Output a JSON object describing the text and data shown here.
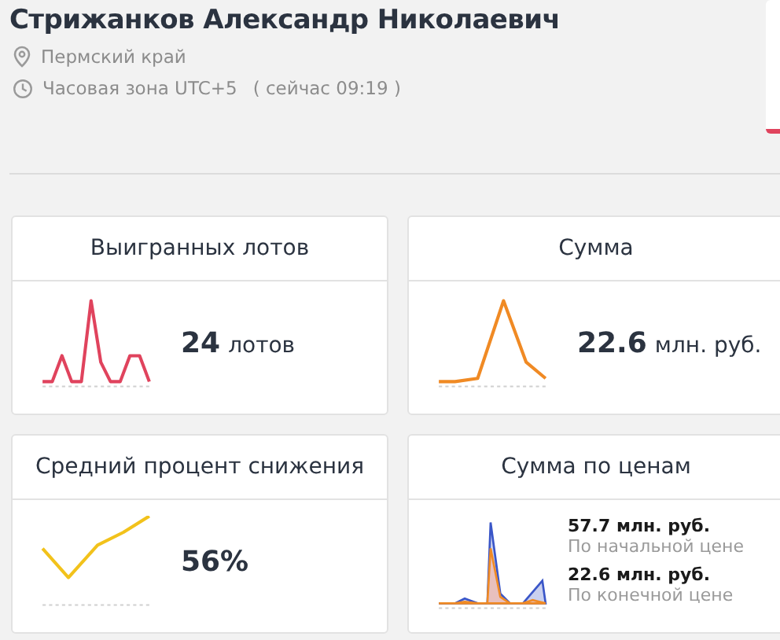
{
  "profile": {
    "name": "Стрижанков Александр Николаевич",
    "region": "Пермский край",
    "timezone": "Часовая зона UTC+5",
    "local_time": "( сейчас 09:19 )"
  },
  "cards": [
    {
      "kind": "single",
      "title": "Выигранных лотов",
      "color": "#e0435d",
      "value": "24",
      "unit": "лотов"
    },
    {
      "kind": "single",
      "title": "Сумма",
      "color": "#f08a24",
      "value": "22.6",
      "unit": "млн. руб."
    },
    {
      "kind": "single",
      "title": "Средний процент снижения",
      "color": "#f2c21b",
      "value": "56%"
    },
    {
      "kind": "double",
      "title": "Сумма по ценам",
      "color": "#3a56c8",
      "items": [
        {
          "value": "57.7 млн. руб.",
          "label": "По начальной цене"
        },
        {
          "value": "22.6 млн. руб.",
          "label": "По конечной цене"
        }
      ]
    }
  ]
}
